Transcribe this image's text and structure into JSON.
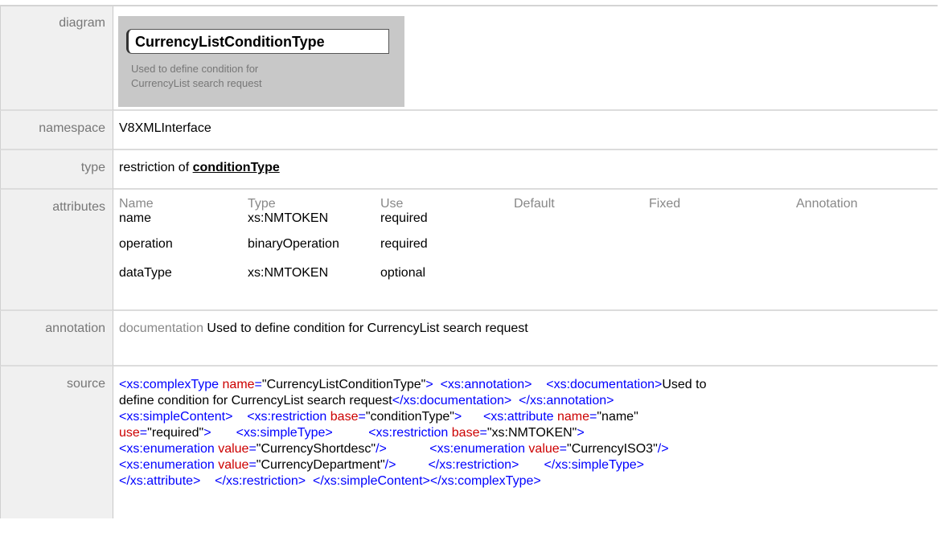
{
  "rows": {
    "diagram": {
      "label": "diagram"
    },
    "namespace": {
      "label": "namespace",
      "value": "V8XMLInterface"
    },
    "type": {
      "label": "type",
      "prefix": "restriction of",
      "link": "conditionType"
    },
    "attributes": {
      "label": "attributes"
    },
    "annotation": {
      "label": "annotation",
      "key": "documentation",
      "text": "Used to define condition for CurrencyList search request"
    },
    "source": {
      "label": "source"
    }
  },
  "diagram": {
    "name": "CurrencyListConditionType",
    "doc_line1": "Used to define condition for",
    "doc_line2": "CurrencyList search request"
  },
  "attributes": {
    "headers": [
      "Name",
      "Type",
      "Use",
      "Default",
      "Fixed",
      "Annotation"
    ],
    "rows": [
      {
        "name": "name",
        "type": "xs:NMTOKEN",
        "use": "required",
        "default": "",
        "fixed": "",
        "annotation": ""
      },
      {
        "name": "operation",
        "type": "binaryOperation",
        "use": "required",
        "default": "",
        "fixed": "",
        "annotation": ""
      },
      {
        "name": "dataType",
        "type": "xs:NMTOKEN",
        "use": "optional",
        "default": "",
        "fixed": "",
        "annotation": ""
      }
    ]
  },
  "source": {
    "colors": {
      "tag": "#0000ff",
      "attr_name": "#cc0000",
      "attr_value": "#000000"
    },
    "t1": "<xs:complexType",
    "a1": "name",
    "v1": "\"CurrencyListConditionType\"",
    "t2": ">",
    "t3": "<xs:annotation>",
    "t4": "<xs:documentation>",
    "x1": "Used to",
    "x2": "define condition for CurrencyList search request",
    "t5": "</xs:documentation>",
    "t6": "</xs:annotation>",
    "t7": "<xs:simpleContent>",
    "t8": "<xs:restriction",
    "a2": "base",
    "v2": "\"conditionType\"",
    "t9": ">",
    "t10": "<xs:attribute",
    "a3": "name",
    "v3": "\"name\"",
    "a4": "use",
    "v4": "\"required\"",
    "t11": ">",
    "t12": "<xs:simpleType>",
    "t13": "<xs:restriction",
    "a5": "base",
    "v5": "\"xs:NMTOKEN\"",
    "t14": ">",
    "t15": "<xs:enumeration",
    "a6": "value",
    "v6": "\"CurrencyShortdesc\"",
    "t16": "/>",
    "t17": "<xs:enumeration",
    "a7": "value",
    "v7": "\"CurrencyISO3\"",
    "t18": "/>",
    "t19": "<xs:enumeration",
    "a8": "value",
    "v8": "\"CurrencyDepartment\"",
    "t20": "/>",
    "t21": "</xs:restriction>",
    "t22": "</xs:simpleType>",
    "t23": "</xs:attribute>",
    "t24": "</xs:restriction>",
    "t25": "</xs:simpleContent>",
    "t26": "</xs:complexType>",
    "eq": "="
  }
}
